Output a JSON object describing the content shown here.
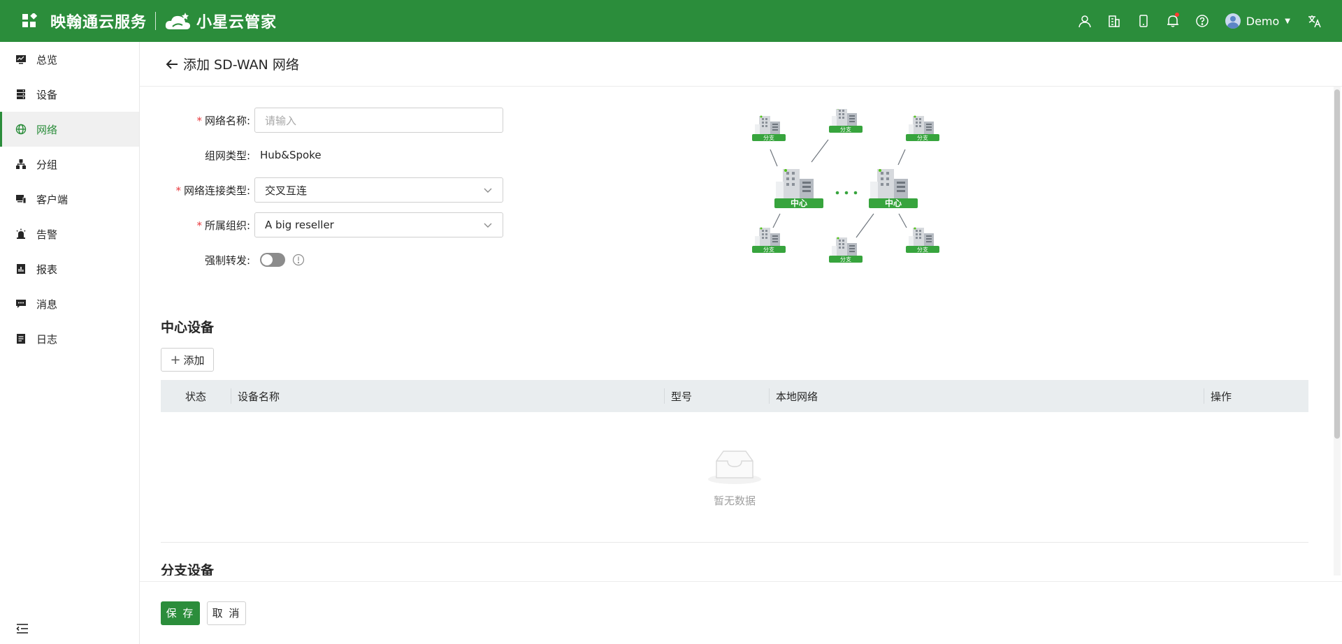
{
  "header": {
    "brand": "映翰通云服务",
    "product": "小星云管家",
    "username": "Demo"
  },
  "sidebar": {
    "items": [
      {
        "label": "总览",
        "icon": "monitor-icon"
      },
      {
        "label": "设备",
        "icon": "server-icon"
      },
      {
        "label": "网络",
        "icon": "globe-icon",
        "active": true
      },
      {
        "label": "分组",
        "icon": "hierarchy-icon"
      },
      {
        "label": "客户端",
        "icon": "devices-icon"
      },
      {
        "label": "告警",
        "icon": "alarm-icon"
      },
      {
        "label": "报表",
        "icon": "report-icon"
      },
      {
        "label": "消息",
        "icon": "message-icon"
      },
      {
        "label": "日志",
        "icon": "log-icon"
      }
    ]
  },
  "page": {
    "title": "添加 SD-WAN 网络"
  },
  "form": {
    "name_label": "网络名称:",
    "name_placeholder": "请输入",
    "type_label": "组网类型:",
    "type_value": "Hub&Spoke",
    "conn_label": "网络连接类型:",
    "conn_value": "交叉互连",
    "org_label": "所属组织:",
    "org_value": "A big reseller",
    "force_label": "强制转发:"
  },
  "diagram": {
    "branch": "分支",
    "hub": "中心"
  },
  "hub_section": {
    "title": "中心设备",
    "add_label": "添加",
    "columns": [
      "状态",
      "设备名称",
      "型号",
      "本地网络",
      "操作"
    ],
    "empty": "暂无数据"
  },
  "branch_section": {
    "title": "分支设备"
  },
  "footer": {
    "save": "保 存",
    "cancel": "取 消"
  },
  "colors": {
    "brand": "#2b8d3b",
    "required": "#e8393d"
  }
}
